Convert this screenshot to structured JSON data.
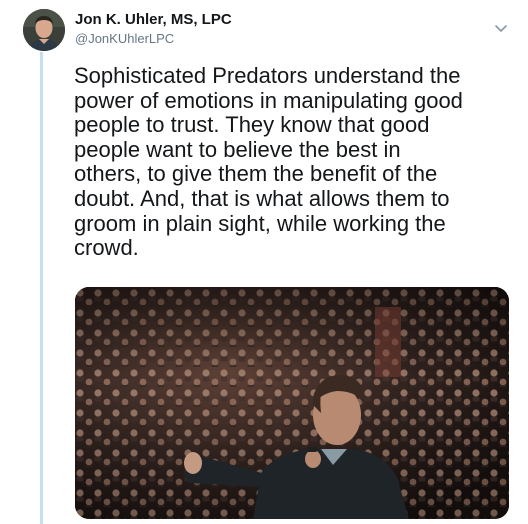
{
  "tweet": {
    "author": {
      "display_name": "Jon K. Uhler, MS, LPC",
      "handle": "@JonKUhlerLPC",
      "avatar_icon": "profile-photo"
    },
    "menu_icon": "chevron-down-icon",
    "text": "Sophisticated Predators understand the\npower of emotions in manipulating good\npeople to trust. They know that good\npeople want to believe the best in\nothers, to give them the benefit of the\ndoubt. And, that is what allows them to\ngroom in plain sight, while working the\ncrowd.",
    "media": {
      "type": "photo"
    }
  },
  "colors": {
    "thread_line": "#c4dff3",
    "text": "#14171a",
    "secondary_text": "#657786"
  }
}
